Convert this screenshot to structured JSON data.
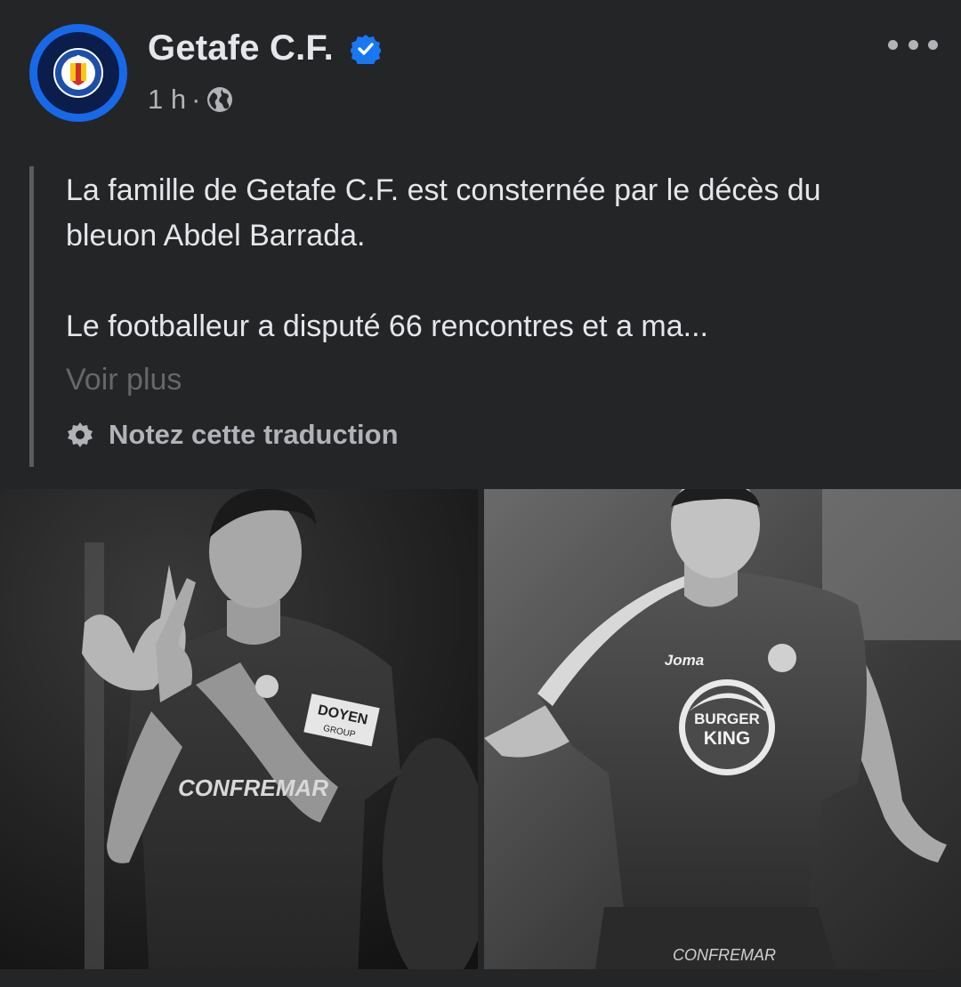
{
  "post": {
    "page_name": "Getafe C.F.",
    "verified": true,
    "time": "1 h",
    "separator": "·",
    "audience_icon": "globe-icon",
    "paragraph_1": "La famille de Getafe C.F. est consternée par le décès du bleuon Abdel Barrada.",
    "paragraph_2": "Le footballeur a disputé 66 rencontres et a ma...",
    "see_more": "Voir plus",
    "rate_translation": "Notez cette traduction"
  },
  "photos": {
    "left": {
      "sponsor_text": "DOYEN",
      "sponsor_sub": "GROUP",
      "chest_text": "CONFREMAR"
    },
    "right": {
      "brand_text": "Joma",
      "sponsor_line1": "BURGER",
      "sponsor_line2": "KING",
      "shorts_text": "CONFREMAR"
    }
  },
  "colors": {
    "background": "#242526",
    "text_primary": "#e4e6eb",
    "text_secondary": "#b0b3b8",
    "see_more": "#65676b",
    "verified_blue": "#1877f2",
    "avatar_ring": "#1769e8"
  }
}
